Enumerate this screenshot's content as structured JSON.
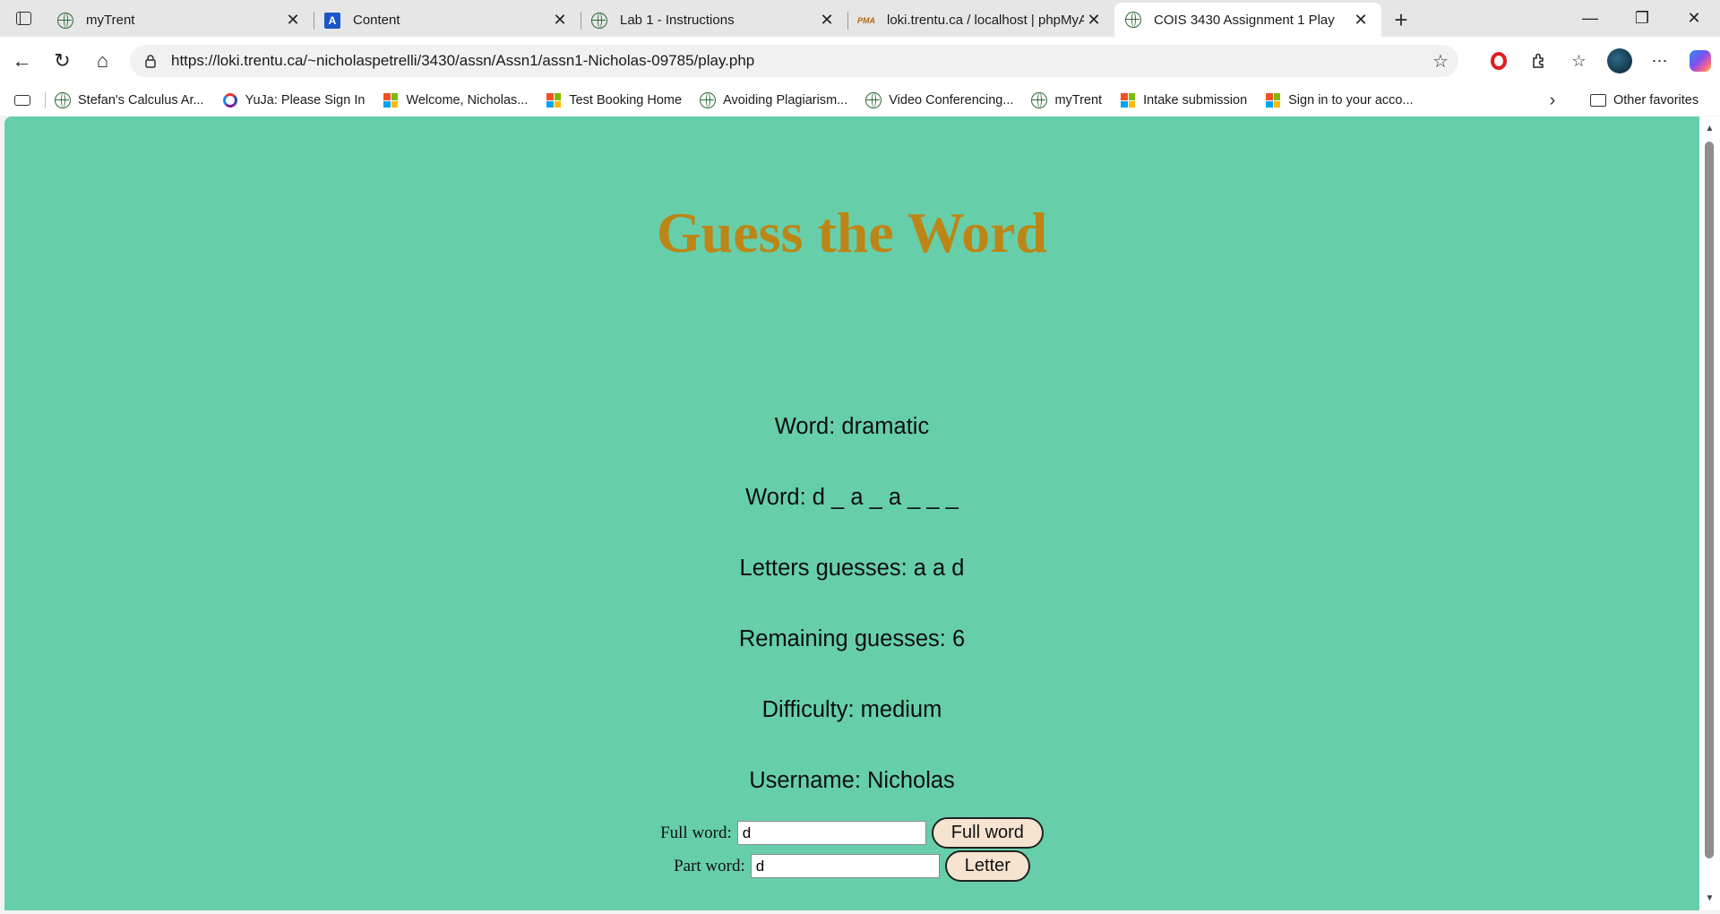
{
  "browser": {
    "tabs": [
      {
        "title": "myTrent",
        "icon": "trent-globe-icon",
        "active": false
      },
      {
        "title": "Content",
        "icon": "content-a-icon",
        "active": false
      },
      {
        "title": "Lab 1 - Instructions",
        "icon": "trent-globe-icon",
        "active": false
      },
      {
        "title": "loki.trentu.ca / localhost | phpMyAdmin",
        "icon": "phpmyadmin-icon",
        "active": false
      },
      {
        "title": "COIS 3430 Assignment 1 Play",
        "icon": "trent-globe-icon",
        "active": true
      }
    ],
    "pma_icon_text": "PMA",
    "content_icon_letter": "A",
    "url": "https://loki.trentu.ca/~nicholaspetrelli/3430/assn/Assn1/assn1-Nicholas-09785/play.php",
    "bookmarks": [
      {
        "label": "Stefan's Calculus Ar...",
        "icon": "trent-globe-icon"
      },
      {
        "label": "YuJa: Please Sign In",
        "icon": "yuja-icon"
      },
      {
        "label": "Welcome, Nicholas...",
        "icon": "microsoft-icon"
      },
      {
        "label": "Test Booking Home",
        "icon": "microsoft-icon"
      },
      {
        "label": "Avoiding Plagiarism...",
        "icon": "trent-globe-icon"
      },
      {
        "label": "Video Conferencing...",
        "icon": "trent-globe-icon"
      },
      {
        "label": "myTrent",
        "icon": "trent-globe-icon"
      },
      {
        "label": "Intake submission",
        "icon": "microsoft-icon"
      },
      {
        "label": "Sign in to your acco...",
        "icon": "microsoft-icon"
      }
    ],
    "other_favorites": "Other favorites"
  },
  "page": {
    "title": "Guess the Word",
    "word": "Word: dramatic",
    "masked_word": "Word: d _ a _ a _ _ _",
    "letters_guessed": "Letters guesses: a a d",
    "remaining_guesses": "Remaining guesses: 6",
    "difficulty": "Difficulty: medium",
    "username": "Username: Nicholas",
    "full_word_label": "Full word:",
    "full_word_value": "d",
    "full_word_button": "Full word",
    "part_word_label": "Part word:",
    "part_word_value": "d",
    "letter_button": "Letter"
  },
  "colors": {
    "page_background": "#66cfa9",
    "title_color": "#bd8516",
    "button_background": "#f6e4d0"
  }
}
